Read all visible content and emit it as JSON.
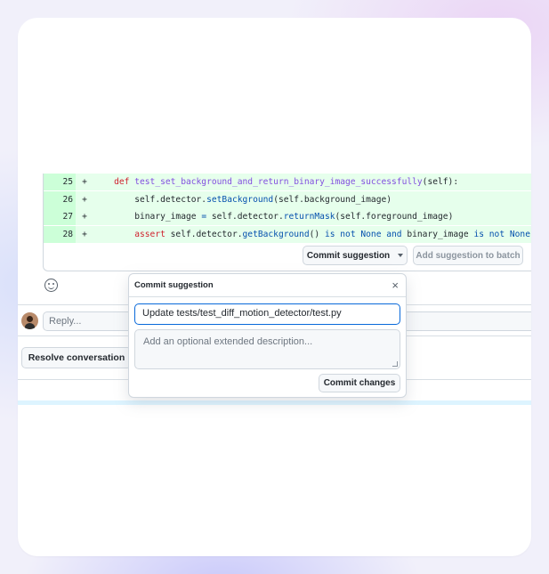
{
  "diff": {
    "lines": [
      {
        "num": "25",
        "sign": "+",
        "indent": "    ",
        "parts": [
          {
            "t": "def ",
            "c": "kw"
          },
          {
            "t": "test_set_background_and_return_binary_image_successfully",
            "c": "fn"
          },
          {
            "t": "(self):",
            "c": ""
          }
        ]
      },
      {
        "num": "26",
        "sign": "+",
        "indent": "        ",
        "parts": [
          {
            "t": "self.detector.",
            "c": ""
          },
          {
            "t": "setBackground",
            "c": "call"
          },
          {
            "t": "(self.background_image)",
            "c": ""
          }
        ]
      },
      {
        "num": "27",
        "sign": "+",
        "indent": "        ",
        "parts": [
          {
            "t": "binary_image ",
            "c": ""
          },
          {
            "t": "=",
            "c": "call"
          },
          {
            "t": " self.detector.",
            "c": ""
          },
          {
            "t": "returnMask",
            "c": "call"
          },
          {
            "t": "(self.foreground_image)",
            "c": ""
          }
        ]
      },
      {
        "num": "28",
        "sign": "+",
        "indent": "        ",
        "parts": [
          {
            "t": "assert",
            "c": "kw"
          },
          {
            "t": " self.detector.",
            "c": ""
          },
          {
            "t": "getBackground",
            "c": "call"
          },
          {
            "t": "() ",
            "c": ""
          },
          {
            "t": "is not None and",
            "c": "call"
          },
          {
            "t": " binary_image ",
            "c": ""
          },
          {
            "t": "is not None",
            "c": "call"
          }
        ]
      }
    ],
    "commit_suggestion_label": "Commit suggestion",
    "add_to_batch_label": "Add suggestion to batch"
  },
  "reply": {
    "placeholder": "Reply..."
  },
  "resolve_label": "Resolve conversation",
  "popup": {
    "title": "Commit suggestion",
    "close_glyph": "×",
    "commit_title_value": "Update tests/test_diff_motion_detector/test.py",
    "description_placeholder": "Add an optional extended description...",
    "commit_changes_label": "Commit changes"
  }
}
